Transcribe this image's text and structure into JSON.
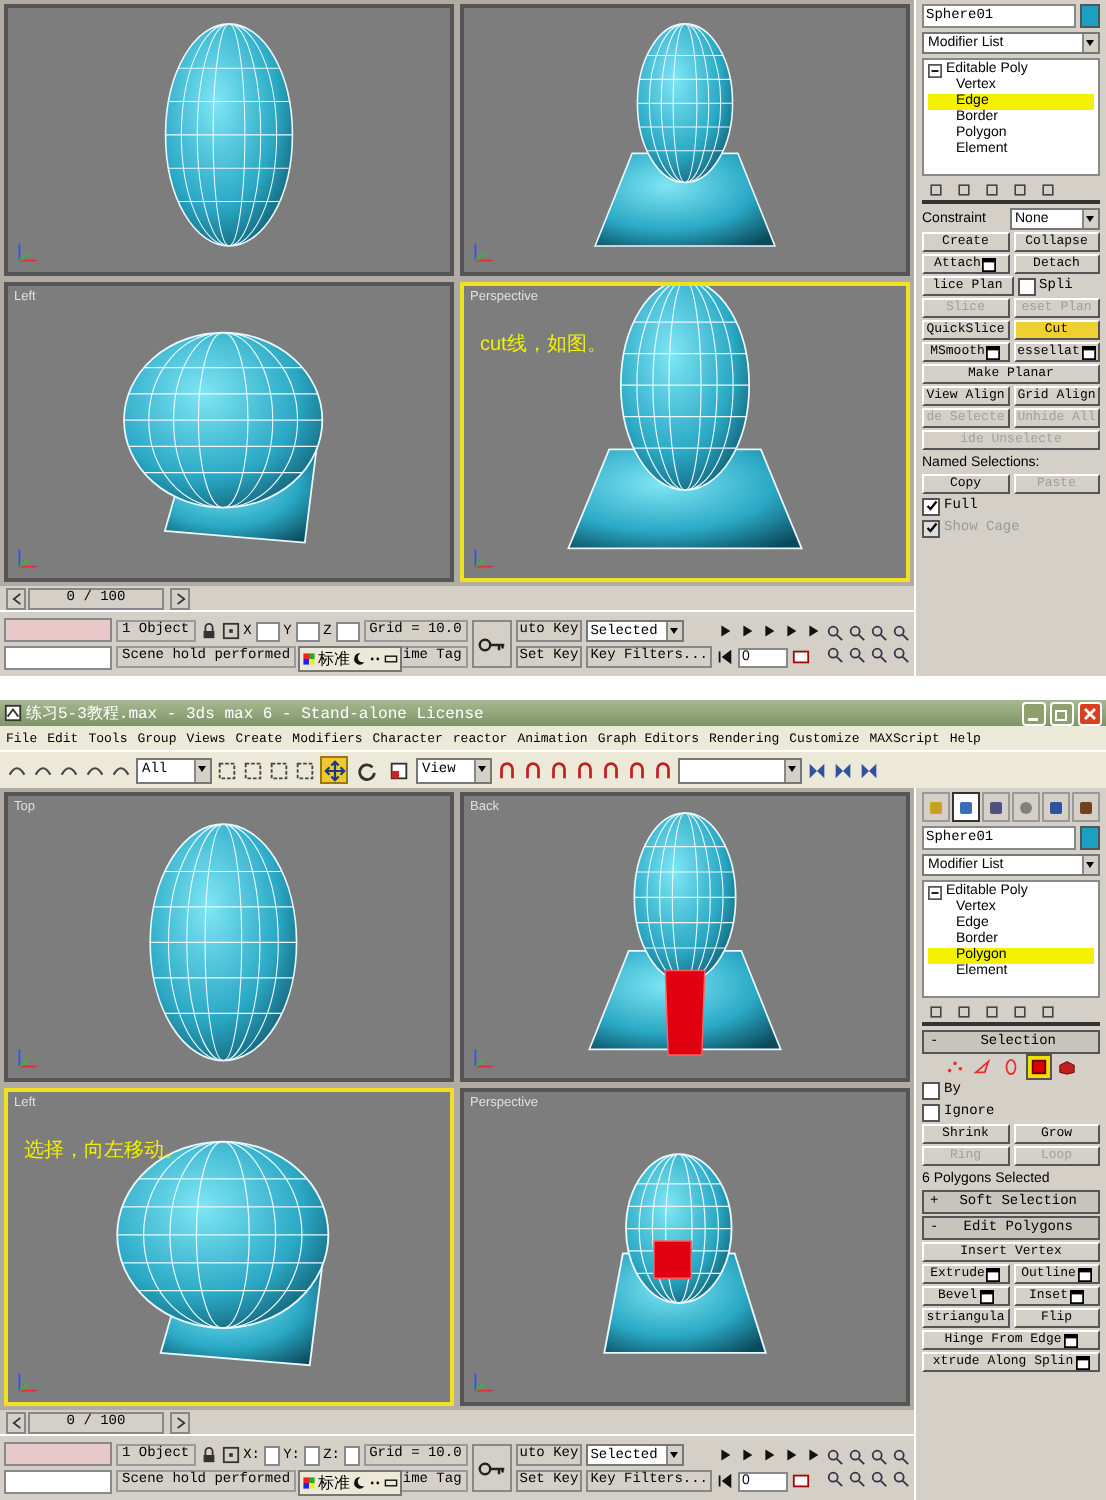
{
  "screenshots": [
    {
      "viewports": [
        {
          "kind": "front-head",
          "active": false
        },
        {
          "kind": "back-bust",
          "active": false
        },
        {
          "label": "Left",
          "kind": "side-helmet",
          "active": false
        },
        {
          "label": "Perspective",
          "kind": "front-bust",
          "active": true,
          "note": "cut线，如图。"
        }
      ],
      "command_panel": {
        "object_name": "Sphere01",
        "modifier_list": "Modifier List",
        "stack": [
          {
            "label": "Editable Poly",
            "expanded": true,
            "children": [
              {
                "label": "Vertex",
                "selected": false
              },
              {
                "label": "Edge",
                "selected": true
              },
              {
                "label": "Border",
                "selected": false
              },
              {
                "label": "Polygon",
                "selected": false
              },
              {
                "label": "Element",
                "selected": false
              }
            ]
          }
        ],
        "rows": [
          {
            "items": [
              {
                "kind": "label",
                "label": "Constraint"
              },
              {
                "kind": "dropdown",
                "label": "None"
              }
            ]
          },
          {
            "items": [
              {
                "kind": "button",
                "label": "Create",
                "disabled": false,
                "selected": false
              },
              {
                "kind": "button",
                "label": "Collapse",
                "disabled": false,
                "selected": false
              }
            ]
          },
          {
            "items": [
              {
                "kind": "button",
                "label": "Attach",
                "settings": true,
                "disabled": false,
                "selected": false
              },
              {
                "kind": "button",
                "label": "Detach",
                "disabled": false,
                "selected": false
              }
            ]
          },
          {
            "items": [
              {
                "kind": "button",
                "label": "lice Plan",
                "disabled": false,
                "selected": false
              },
              {
                "kind": "checkbox",
                "label": "Spli",
                "checked": false,
                "disabled": false
              }
            ]
          },
          {
            "items": [
              {
                "kind": "button",
                "label": "Slice",
                "disabled": true,
                "selected": false
              },
              {
                "kind": "button",
                "label": "eset Plan",
                "disabled": true,
                "selected": false
              }
            ]
          },
          {
            "items": [
              {
                "kind": "button",
                "label": "QuickSlice",
                "disabled": false,
                "selected": false
              },
              {
                "kind": "button",
                "label": "Cut",
                "disabled": false,
                "selected": true
              }
            ]
          },
          {
            "items": [
              {
                "kind": "button",
                "label": "MSmooth",
                "settings": true,
                "disabled": false,
                "selected": false
              },
              {
                "kind": "button",
                "label": "essellat",
                "settings": true,
                "disabled": false,
                "selected": false
              }
            ]
          },
          {
            "items": [
              {
                "kind": "button",
                "label": "Make Planar",
                "disabled": false,
                "selected": false
              }
            ]
          },
          {
            "items": [
              {
                "kind": "button",
                "label": "View Align",
                "disabled": false,
                "selected": false
              },
              {
                "kind": "button",
                "label": "Grid Align",
                "disabled": false,
                "selected": false
              }
            ]
          },
          {
            "items": [
              {
                "kind": "button",
                "label": "de Selecte",
                "disabled": true,
                "selected": false
              },
              {
                "kind": "button",
                "label": "Unhide All",
                "disabled": true,
                "selected": false
              }
            ]
          },
          {
            "items": [
              {
                "kind": "button",
                "label": "ide Unselecte",
                "disabled": true,
                "selected": false
              }
            ]
          },
          {
            "items": [
              {
                "kind": "label",
                "label": "Named Selections:"
              }
            ]
          },
          {
            "items": [
              {
                "kind": "button",
                "label": "Copy",
                "disabled": false,
                "selected": false
              },
              {
                "kind": "button",
                "label": "Paste",
                "disabled": true,
                "selected": false
              }
            ]
          },
          {
            "items": [
              {
                "kind": "checkbox",
                "label": "Full",
                "checked": true,
                "disabled": false
              }
            ]
          },
          {
            "items": [
              {
                "kind": "checkbox",
                "label": "Show Cage",
                "checked": true,
                "disabled": true
              }
            ]
          }
        ]
      },
      "time_slider": {
        "label": "0 / 100",
        "level": 0
      },
      "status_bar": {
        "object_count": "1 Object",
        "prompt": "Scene hold performed",
        "coord_labels": [
          "X",
          "Y",
          "Z"
        ],
        "grid": "Grid = 10.0",
        "auto_key": "uto Key",
        "set_key": "Set Key",
        "key_mode": "Selected",
        "key_filters": "Key Filters...",
        "time_tag": "ime Tag",
        "frame": "0",
        "ime": "标准"
      }
    },
    {
      "title_bar": "练习5-3教程.max - 3ds max 6 - Stand-alone License",
      "menu": [
        "File",
        "Edit",
        "Tools",
        "Group",
        "Views",
        "Create",
        "Modifiers",
        "Character",
        "reactor",
        "Animation",
        "Graph Editors",
        "Rendering",
        "Customize",
        "MAXScript",
        "Help"
      ],
      "toolbar": {
        "selection_filter": "All",
        "reference_coord": "View",
        "transform_tools": [
          {
            "kind": "move",
            "selected": true
          },
          {
            "kind": "rotate",
            "selected": false
          },
          {
            "kind": "scale",
            "selected": false
          }
        ]
      },
      "viewports": [
        {
          "label": "Top",
          "kind": "top-head",
          "active": false
        },
        {
          "label": "Back",
          "kind": "back-bust-selected",
          "active": false
        },
        {
          "label": "Left",
          "kind": "side-helmet",
          "active": true,
          "note": "选择，向左移动。"
        },
        {
          "label": "Perspective",
          "kind": "low-bust",
          "active": false
        }
      ],
      "command_panel": {
        "tabs": [
          {
            "kind": "create",
            "selected": false
          },
          {
            "kind": "modify",
            "selected": true
          },
          {
            "kind": "hierarchy",
            "selected": false
          },
          {
            "kind": "motion",
            "selected": false
          },
          {
            "kind": "display",
            "selected": false
          },
          {
            "kind": "utilities",
            "selected": false
          }
        ],
        "object_name": "Sphere01",
        "modifier_list": "Modifier List",
        "stack": [
          {
            "label": "Editable Poly",
            "expanded": true,
            "children": [
              {
                "label": "Vertex",
                "selected": false
              },
              {
                "label": "Edge",
                "selected": false
              },
              {
                "label": "Border",
                "selected": false
              },
              {
                "label": "Polygon",
                "selected": true
              },
              {
                "label": "Element",
                "selected": false
              }
            ]
          }
        ],
        "rows": [
          {
            "items": [
              {
                "kind": "rollout",
                "sign": "-",
                "label": "Selection"
              }
            ]
          },
          {
            "items": [
              {
                "kind": "modes",
                "modes": [
                  {
                    "kind": "vertex",
                    "selected": false
                  },
                  {
                    "kind": "edge",
                    "selected": false
                  },
                  {
                    "kind": "border",
                    "selected": false
                  },
                  {
                    "kind": "polygon",
                    "selected": true
                  },
                  {
                    "kind": "element",
                    "selected": false
                  }
                ]
              }
            ]
          },
          {
            "items": [
              {
                "kind": "checkbox",
                "label": "By",
                "checked": false,
                "disabled": false
              }
            ]
          },
          {
            "items": [
              {
                "kind": "checkbox",
                "label": "Ignore",
                "checked": false,
                "disabled": false
              }
            ]
          },
          {
            "items": [
              {
                "kind": "button",
                "label": "Shrink",
                "disabled": false,
                "selected": false
              },
              {
                "kind": "button",
                "label": "Grow",
                "disabled": false,
                "selected": false
              }
            ]
          },
          {
            "items": [
              {
                "kind": "button",
                "label": "Ring",
                "disabled": true,
                "selected": false
              },
              {
                "kind": "button",
                "label": "Loop",
                "disabled": true,
                "selected": false
              }
            ]
          },
          {
            "items": [
              {
                "kind": "label",
                "label": "6 Polygons Selected"
              }
            ]
          },
          {
            "items": [
              {
                "kind": "rollout",
                "sign": "+",
                "label": "Soft Selection"
              }
            ]
          },
          {
            "items": [
              {
                "kind": "rollout",
                "sign": "-",
                "label": "Edit Polygons"
              }
            ]
          },
          {
            "items": [
              {
                "kind": "button",
                "label": "Insert Vertex",
                "disabled": false,
                "selected": false
              }
            ]
          },
          {
            "items": [
              {
                "kind": "button",
                "label": "Extrude",
                "settings": true,
                "disabled": false,
                "selected": false
              },
              {
                "kind": "button",
                "label": "Outline",
                "settings": true,
                "disabled": false,
                "selected": false
              }
            ]
          },
          {
            "items": [
              {
                "kind": "button",
                "label": "Bevel",
                "settings": true,
                "disabled": false,
                "selected": false
              },
              {
                "kind": "button",
                "label": "Inset",
                "settings": true,
                "disabled": false,
                "selected": false
              }
            ]
          },
          {
            "items": [
              {
                "kind": "button",
                "label": "striangula",
                "disabled": false,
                "selected": false
              },
              {
                "kind": "button",
                "label": "Flip",
                "disabled": false,
                "selected": false
              }
            ]
          },
          {
            "items": [
              {
                "kind": "button",
                "label": "Hinge From Edge",
                "settings": true,
                "disabled": false,
                "selected": false
              }
            ]
          },
          {
            "items": [
              {
                "kind": "button",
                "label": "xtrude Along Splin",
                "settings": true,
                "disabled": false,
                "selected": false
              }
            ]
          }
        ]
      },
      "time_slider": {
        "label": "0 / 100",
        "level": 0
      },
      "status_bar": {
        "object_count": "1 Object",
        "prompt": "Scene hold performed",
        "coord_labels": [
          "X:",
          "Y:",
          "Z:"
        ],
        "grid": "Grid = 10.0",
        "auto_key": "uto Key",
        "set_key": "Set Key",
        "key_mode": "Selected",
        "key_filters": "Key Filters...",
        "time_tag": "ime Tag",
        "frame": "0",
        "ime": "标准"
      }
    }
  ]
}
